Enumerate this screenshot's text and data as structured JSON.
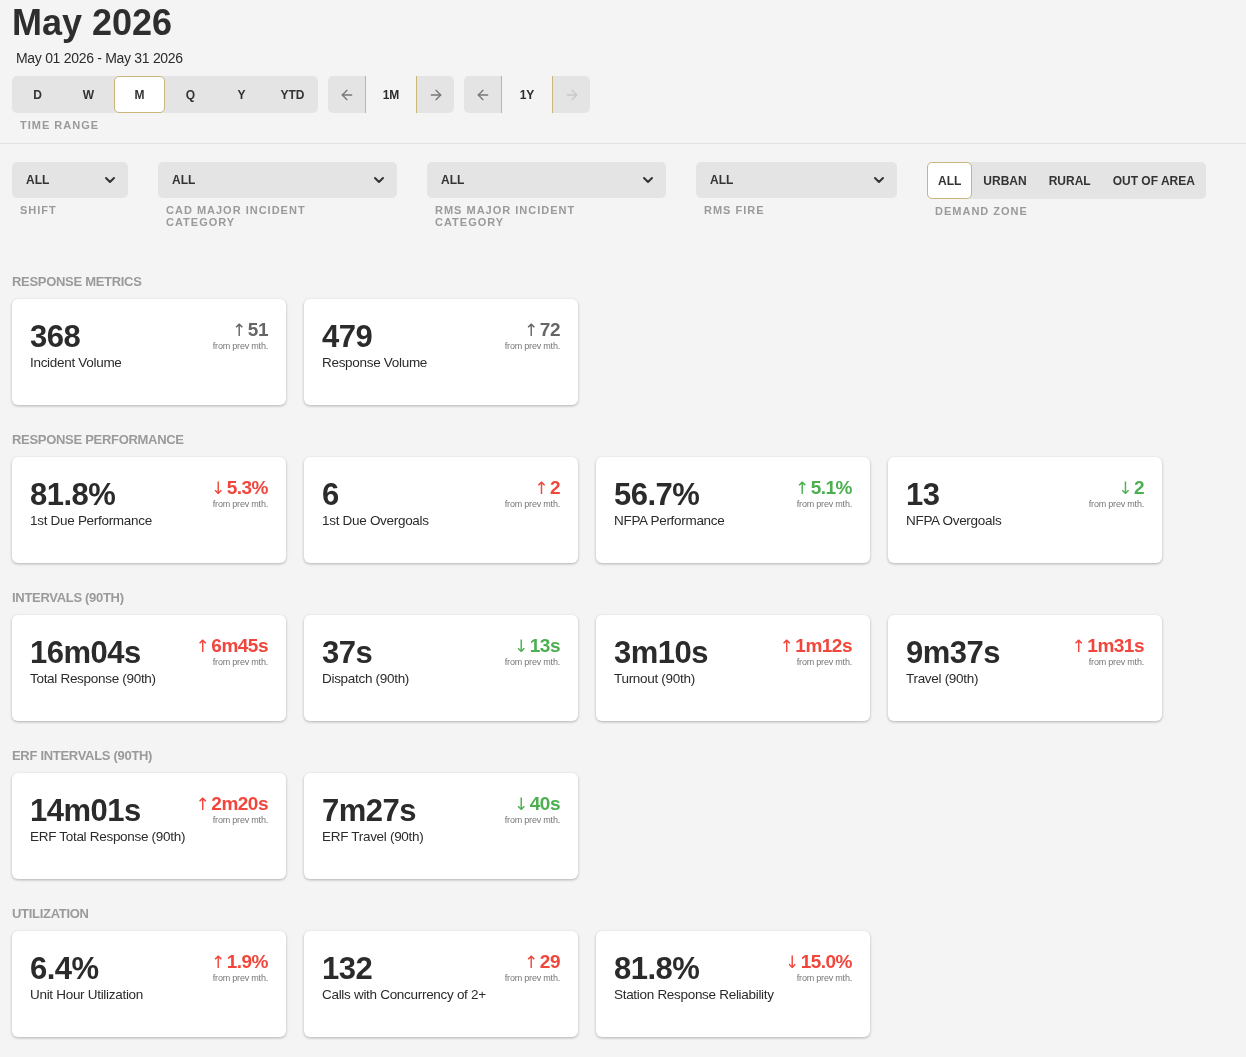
{
  "title": "May 2026",
  "date_range": "May 01 2026 - May 31 2026",
  "time_range": {
    "label": "TIME RANGE",
    "options": [
      {
        "label": "D",
        "selected": false
      },
      {
        "label": "W",
        "selected": false
      },
      {
        "label": "M",
        "selected": true
      },
      {
        "label": "Q",
        "selected": false
      },
      {
        "label": "Y",
        "selected": false
      },
      {
        "label": "YTD",
        "selected": false
      }
    ]
  },
  "steppers": [
    {
      "value": "1M",
      "prev_disabled": false,
      "next_disabled": false
    },
    {
      "value": "1Y",
      "prev_disabled": false,
      "next_disabled": true
    }
  ],
  "filters": [
    {
      "kind": "dropdown",
      "value": "ALL",
      "label": "SHIFT"
    },
    {
      "kind": "dropdown",
      "value": "ALL",
      "label": "CAD MAJOR INCIDENT CATEGORY"
    },
    {
      "kind": "dropdown",
      "value": "ALL",
      "label": "RMS MAJOR INCIDENT CATEGORY"
    },
    {
      "kind": "dropdown",
      "value": "ALL",
      "label": "RMS FIRE"
    },
    {
      "kind": "segmented",
      "label": "DEMAND ZONE",
      "options": [
        {
          "label": "ALL",
          "selected": true
        },
        {
          "label": "URBAN",
          "selected": false
        },
        {
          "label": "RURAL",
          "selected": false
        },
        {
          "label": "OUT OF AREA",
          "selected": false
        }
      ]
    }
  ],
  "sections": [
    {
      "title": "RESPONSE METRICS",
      "cards": [
        {
          "value": "368",
          "label": "Incident Volume",
          "direction": "↑",
          "change": "51",
          "color": "#666666",
          "note": "from prev mth."
        },
        {
          "value": "479",
          "label": "Response Volume",
          "direction": "↑",
          "change": "72",
          "color": "#666666",
          "note": "from prev mth."
        }
      ]
    },
    {
      "title": "RESPONSE PERFORMANCE",
      "cards": [
        {
          "value": "81.8%",
          "label": "1st Due Performance",
          "direction": "↓",
          "change": "5.3%",
          "color": "#f0463c",
          "note": "from prev mth."
        },
        {
          "value": "6",
          "label": "1st Due Overgoals",
          "direction": "↑",
          "change": "2",
          "color": "#f0463c",
          "note": "from prev mth."
        },
        {
          "value": "56.7%",
          "label": "NFPA Performance",
          "direction": "↑",
          "change": "5.1%",
          "color": "#4caf50",
          "note": "from prev mth."
        },
        {
          "value": "13",
          "label": "NFPA Overgoals",
          "direction": "↓",
          "change": "2",
          "color": "#4caf50",
          "note": "from prev mth."
        }
      ]
    },
    {
      "title": "INTERVALS (90TH)",
      "cards": [
        {
          "value": "16m04s",
          "label": "Total Response (90th)",
          "direction": "↑",
          "change": "6m45s",
          "color": "#f0463c",
          "note": "from prev mth."
        },
        {
          "value": "37s",
          "label": "Dispatch (90th)",
          "direction": "↓",
          "change": "13s",
          "color": "#4caf50",
          "note": "from prev mth."
        },
        {
          "value": "3m10s",
          "label": "Turnout (90th)",
          "direction": "↑",
          "change": "1m12s",
          "color": "#f0463c",
          "note": "from prev mth."
        },
        {
          "value": "9m37s",
          "label": "Travel (90th)",
          "direction": "↑",
          "change": "1m31s",
          "color": "#f0463c",
          "note": "from prev mth."
        }
      ]
    },
    {
      "title": "ERF INTERVALS (90TH)",
      "cards": [
        {
          "value": "14m01s",
          "label": "ERF Total Response (90th)",
          "direction": "↑",
          "change": "2m20s",
          "color": "#f0463c",
          "note": "from prev mth."
        },
        {
          "value": "7m27s",
          "label": "ERF Travel (90th)",
          "direction": "↓",
          "change": "40s",
          "color": "#4caf50",
          "note": "from prev mth."
        }
      ]
    },
    {
      "title": "UTILIZATION",
      "cards": [
        {
          "value": "6.4%",
          "label": "Unit Hour Utilization",
          "direction": "↑",
          "change": "1.9%",
          "color": "#f0463c",
          "note": "from prev mth."
        },
        {
          "value": "132",
          "label": "Calls with Concurrency of 2+",
          "direction": "↑",
          "change": "29",
          "color": "#f0463c",
          "note": "from prev mth."
        },
        {
          "value": "81.8%",
          "label": "Station Response Reliability",
          "direction": "↓",
          "change": "15.0%",
          "color": "#f0463c",
          "note": "from prev mth."
        }
      ]
    }
  ]
}
